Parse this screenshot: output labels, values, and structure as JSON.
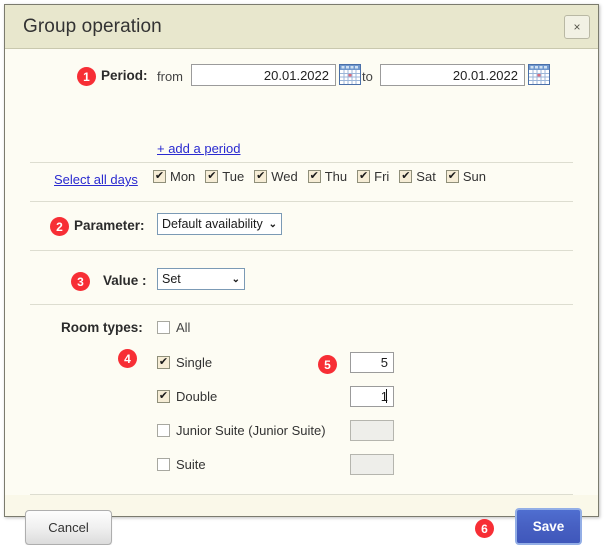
{
  "dialog": {
    "title": "Group operation",
    "close_label": "×"
  },
  "period": {
    "badge": "1",
    "label": "Period:",
    "from_label": "from",
    "from_value": "20.01.2022",
    "to_label": "to",
    "to_value": "20.01.2022",
    "add_period_link": "+ add a period",
    "calendar_icon_name": "calendar-icon"
  },
  "days": {
    "select_all_link": "Select all days",
    "items": [
      {
        "label": "Mon",
        "checked": true
      },
      {
        "label": "Tue",
        "checked": true
      },
      {
        "label": "Wed",
        "checked": true
      },
      {
        "label": "Thu",
        "checked": true
      },
      {
        "label": "Fri",
        "checked": true
      },
      {
        "label": "Sat",
        "checked": true
      },
      {
        "label": "Sun",
        "checked": true
      }
    ],
    "check_glyph": "✔"
  },
  "parameter": {
    "badge": "2",
    "label": "Parameter:",
    "selected": "Default availability",
    "caret": "⌄"
  },
  "value": {
    "badge": "3",
    "label": "Value :",
    "selected": "Set",
    "caret": "⌄"
  },
  "room_types": {
    "label": "Room types:",
    "badge_rows": "4",
    "badge_qty": "5",
    "all": {
      "label": "All",
      "checked": false
    },
    "rows": [
      {
        "label": "Single",
        "checked": true,
        "qty": "5",
        "qty_disabled": false
      },
      {
        "label": "Double",
        "checked": true,
        "qty": "1",
        "qty_disabled": false
      },
      {
        "label": "Junior Suite (Junior Suite)",
        "checked": false,
        "qty": "",
        "qty_disabled": true
      },
      {
        "label": "Suite",
        "checked": false,
        "qty": "",
        "qty_disabled": true
      }
    ]
  },
  "footer": {
    "cancel_label": "Cancel",
    "save_label": "Save",
    "save_badge": "6"
  },
  "colors": {
    "titlebar_bg": "#e8e7cd",
    "body_bg": "#fdfcf3",
    "footer_bg": "#faf8e9",
    "badge_red": "#f72e35",
    "link_blue": "#2a2ad0",
    "save_blue": "#4760c2",
    "checkbox_fill": "#f6edd6"
  }
}
